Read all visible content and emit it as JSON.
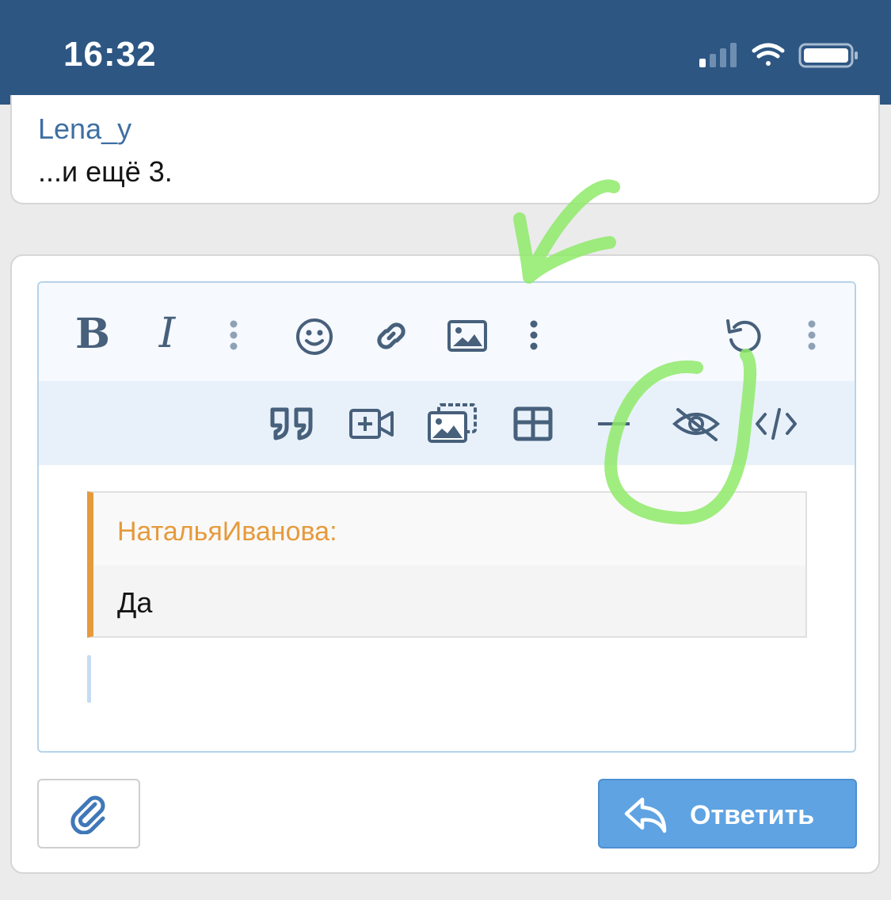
{
  "status_bar": {
    "time": "16:32",
    "icons": [
      "signal-icon",
      "wifi-icon",
      "battery-icon"
    ]
  },
  "post": {
    "user": "Lena_y",
    "more": "...и ещё 3."
  },
  "toolbar": {
    "row1": [
      "bold",
      "italic",
      "more-text-options",
      "emoji",
      "link",
      "image",
      "more-insert-options",
      "undo",
      "more-options"
    ],
    "bold_label": "B",
    "italic_label": "I",
    "row2": [
      "quote",
      "media",
      "gallery",
      "table",
      "horizontal-line",
      "spoiler",
      "code"
    ]
  },
  "editor": {
    "quote_author": "НатальяИванова:",
    "quote_text": "Да"
  },
  "actions": {
    "reply_label": "Ответить"
  },
  "colors": {
    "status_bar": "#2d5683",
    "link": "#3f6fa3",
    "icon": "#47607b",
    "quote_accent": "#e69a3c",
    "reply_button": "#5fa3e2",
    "annotation": "#8fea6a"
  }
}
